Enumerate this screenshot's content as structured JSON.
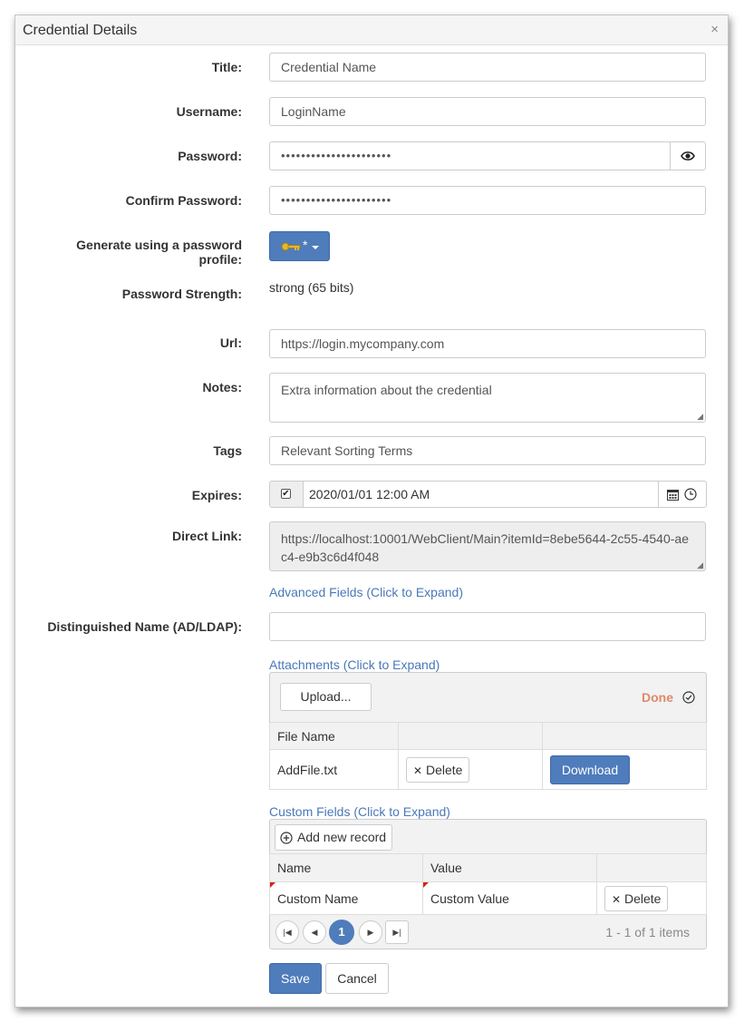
{
  "dialog": {
    "title": "Credential Details",
    "close_icon": "×"
  },
  "labels": {
    "title": "Title:",
    "username": "Username:",
    "password": "Password:",
    "confirm_password": "Confirm Password:",
    "generate_line1": "Generate using a password",
    "generate_line2": "profile:",
    "strength": "Password Strength:",
    "url": "Url:",
    "notes": "Notes:",
    "tags": "Tags",
    "expires": "Expires:",
    "direct_link": "Direct Link:",
    "dn": "Distinguished Name (AD/LDAP):"
  },
  "fields": {
    "title": "Credential Name",
    "username": "LoginName",
    "password": "••••••••••••••••••••••",
    "confirm_password": "••••••••••••••••••••••",
    "generate_caret": "*",
    "strength": "strong (65 bits)",
    "url": "https://login.mycompany.com",
    "notes": "Extra information about the credential",
    "tags": "Relevant Sorting Terms",
    "expires": "2020/01/01 12:00 AM",
    "expires_checked": true,
    "direct_link": "https://localhost:10001/WebClient/Main?itemId=8ebe5644-2c55-4540-aec4-e9b3c6d4f048",
    "dn": ""
  },
  "links": {
    "advanced": "Advanced Fields (Click to Expand)",
    "attachments": "Attachments (Click to Expand)",
    "custom": "Custom Fields (Click to Expand)"
  },
  "attachments": {
    "upload_label": "Upload...",
    "status": "Done",
    "columns": [
      "File Name",
      "",
      ""
    ],
    "rows": [
      {
        "file": "AddFile.txt",
        "delete": "Delete",
        "download": "Download"
      }
    ]
  },
  "custom_fields": {
    "add_label": "Add new record",
    "columns": [
      "Name",
      "Value",
      ""
    ],
    "rows": [
      {
        "name": "Custom Name",
        "value": "Custom Value",
        "delete": "Delete"
      }
    ],
    "page": "1",
    "summary": "1 - 1 of 1 items"
  },
  "footer": {
    "save": "Save",
    "cancel": "Cancel"
  },
  "colors": {
    "primary": "#4f7cbb",
    "link": "#4a78b8",
    "status_done": "#e0886a",
    "required_marker": "#d9230f"
  },
  "icons": {
    "close": "close-icon",
    "eye": "eye-icon",
    "key": "key-icon",
    "calendar": "calendar-icon",
    "clock": "clock-icon",
    "check_circle": "check-circle-icon",
    "plus_circle": "plus-circle-icon",
    "x": "x-icon"
  }
}
